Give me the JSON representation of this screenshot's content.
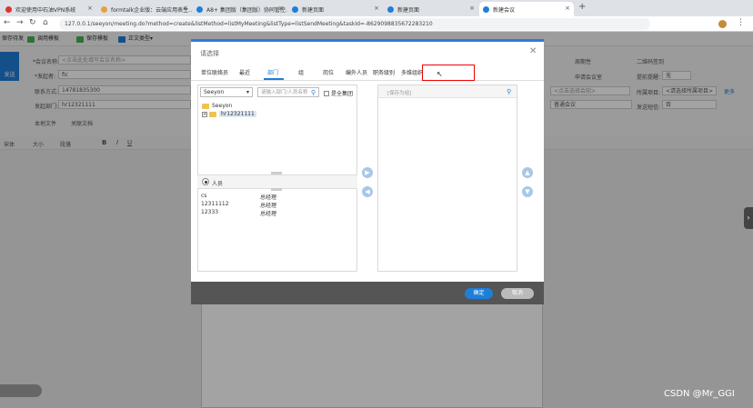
{
  "browser": {
    "tabs": [
      {
        "label": "欢迎使用中石油VPN系统",
        "color": "#d33"
      },
      {
        "label": "formtalk企业版：云端应用表生…",
        "color": "#e8a13a"
      },
      {
        "label": "A8+ 集团版（集团版）协同管控…",
        "color": "#1f7ed8"
      },
      {
        "label": "新建页面",
        "color": "#1f7ed8"
      },
      {
        "label": "新建页面",
        "color": "#1f7ed8"
      },
      {
        "label": "新建会议",
        "color": "#1f7ed8"
      }
    ],
    "url": "127.0.0.1/seeyon/meeting.do?method=create&listMethod=listMyMeeting&listType=listSendMeeting&taskId=-8629098835672283210"
  },
  "toolbar": {
    "items": [
      "保存待发",
      "调用模板",
      "保存模板",
      "正文类型"
    ]
  },
  "form": {
    "send_label": "发送",
    "meeting_name_label": "*会议名称:",
    "meeting_name_placeholder": "<点击此处填写会议名称>",
    "initiator_label": "*发起者:",
    "initiator_value": "fic",
    "contact_label": "联系方式:",
    "contact_value": "14781835300",
    "dept_label": "发起部门:",
    "dept_value": "hr12321111",
    "attach_local": "本地文件",
    "attach_doc": "关联文档",
    "cycle_label": "周期性",
    "apply_room": "申请会议室",
    "qrcode": "二维码签到",
    "remind_label": "提前提醒:",
    "remind_value": "无",
    "select_meeting_room": "<点击选择会知>",
    "project_label": "所属项目:",
    "project_value": "<请选择所属项目>",
    "more": "更多",
    "meeting_type": "普通会议",
    "sms_label": "发送短信:",
    "sms_value": "否"
  },
  "editor": {
    "font": "宋体",
    "size": "大小",
    "style": "段落"
  },
  "dialog": {
    "title": "请选择",
    "tabs": [
      "单位联络员",
      "最近",
      "部门",
      "组",
      "岗位",
      "编外人员",
      "职务级别",
      "多维组织"
    ],
    "active_tab": "部门",
    "org_select": "Seeyon",
    "search_placeholder": "请输入部门/人员名称",
    "all_group": "是全集团",
    "tree": [
      {
        "label": "Seeyon"
      },
      {
        "label": "hr12321111"
      }
    ],
    "persons_label": "人员",
    "persons": [
      {
        "name": "cs",
        "title": "总经理"
      },
      {
        "name": "12311112",
        "title": "总经理"
      },
      {
        "name": "12333",
        "title": "总经理"
      }
    ],
    "selected_header": "[保存为组]",
    "ok": "确定",
    "cancel": "取消"
  },
  "watermark": "CSDN @Mr_GGI"
}
